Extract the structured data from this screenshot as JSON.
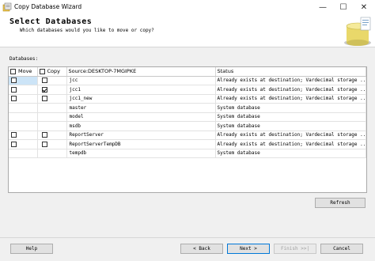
{
  "window": {
    "title": "Copy Database Wizard",
    "minimize": "—",
    "maximize": "☐",
    "close": "✕"
  },
  "header": {
    "title": "Select Databases",
    "subtitle": "Which databases would you like to move or copy?"
  },
  "databases_label": "Databases:",
  "grid": {
    "columns": {
      "move": "Move",
      "copy": "Copy",
      "source": "Source:DESKTOP-7MGIPKE",
      "status": "Status"
    },
    "rows": [
      {
        "move": false,
        "copy": false,
        "has_checkboxes": true,
        "name": "jcc",
        "status": "Already exists at destination; Vardecimal storage ..."
      },
      {
        "move": false,
        "copy": true,
        "has_checkboxes": true,
        "name": "jcc1",
        "status": "Already exists at destination; Vardecimal storage ..."
      },
      {
        "move": false,
        "copy": false,
        "has_checkboxes": true,
        "name": "jcc1_new",
        "status": "Already exists at destination; Vardecimal storage ..."
      },
      {
        "move": false,
        "copy": false,
        "has_checkboxes": false,
        "name": "master",
        "status": "System database"
      },
      {
        "move": false,
        "copy": false,
        "has_checkboxes": false,
        "name": "model",
        "status": "System database"
      },
      {
        "move": false,
        "copy": false,
        "has_checkboxes": false,
        "name": "msdb",
        "status": "System database"
      },
      {
        "move": false,
        "copy": false,
        "has_checkboxes": true,
        "name": "ReportServer",
        "status": "Already exists at destination; Vardecimal storage ..."
      },
      {
        "move": false,
        "copy": false,
        "has_checkboxes": true,
        "name": "ReportServerTempDB",
        "status": "Already exists at destination; Vardecimal storage ..."
      },
      {
        "move": false,
        "copy": false,
        "has_checkboxes": false,
        "name": "tempdb",
        "status": "System database"
      }
    ]
  },
  "buttons": {
    "refresh": "Refresh",
    "help": "Help",
    "back": "< Back",
    "next": "Next >",
    "finish": "Finish >>|",
    "cancel": "Cancel"
  }
}
